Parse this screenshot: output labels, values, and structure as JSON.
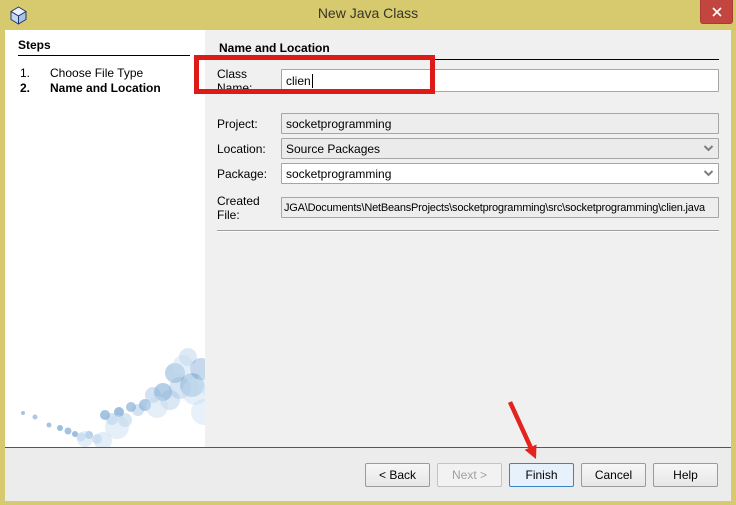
{
  "window": {
    "title": "New Java Class"
  },
  "steps_panel": {
    "heading": "Steps",
    "items": [
      {
        "number": "1.",
        "label": "Choose File Type"
      },
      {
        "number": "2.",
        "label": "Name and Location"
      }
    ]
  },
  "main": {
    "heading": "Name and Location",
    "fields": {
      "class_name": {
        "label": "Class Name:",
        "value": "clien"
      },
      "project": {
        "label": "Project:",
        "value": "socketprogramming"
      },
      "location": {
        "label": "Location:",
        "value": "Source Packages"
      },
      "package": {
        "label": "Package:",
        "value": "socketprogramming"
      },
      "created_file": {
        "label": "Created File:",
        "value": "JGA\\Documents\\NetBeansProjects\\socketprogramming\\src\\socketprogramming\\clien.java"
      }
    }
  },
  "buttons": {
    "back": "< Back",
    "next": "Next >",
    "finish": "Finish",
    "cancel": "Cancel",
    "help": "Help"
  },
  "colors": {
    "titlebar": "#d7ca6e",
    "close_button": "#c2463f",
    "annotation_red": "#dd1a18",
    "finish_focus_border": "#3c84c8",
    "main_background": "#f0f0f0"
  }
}
